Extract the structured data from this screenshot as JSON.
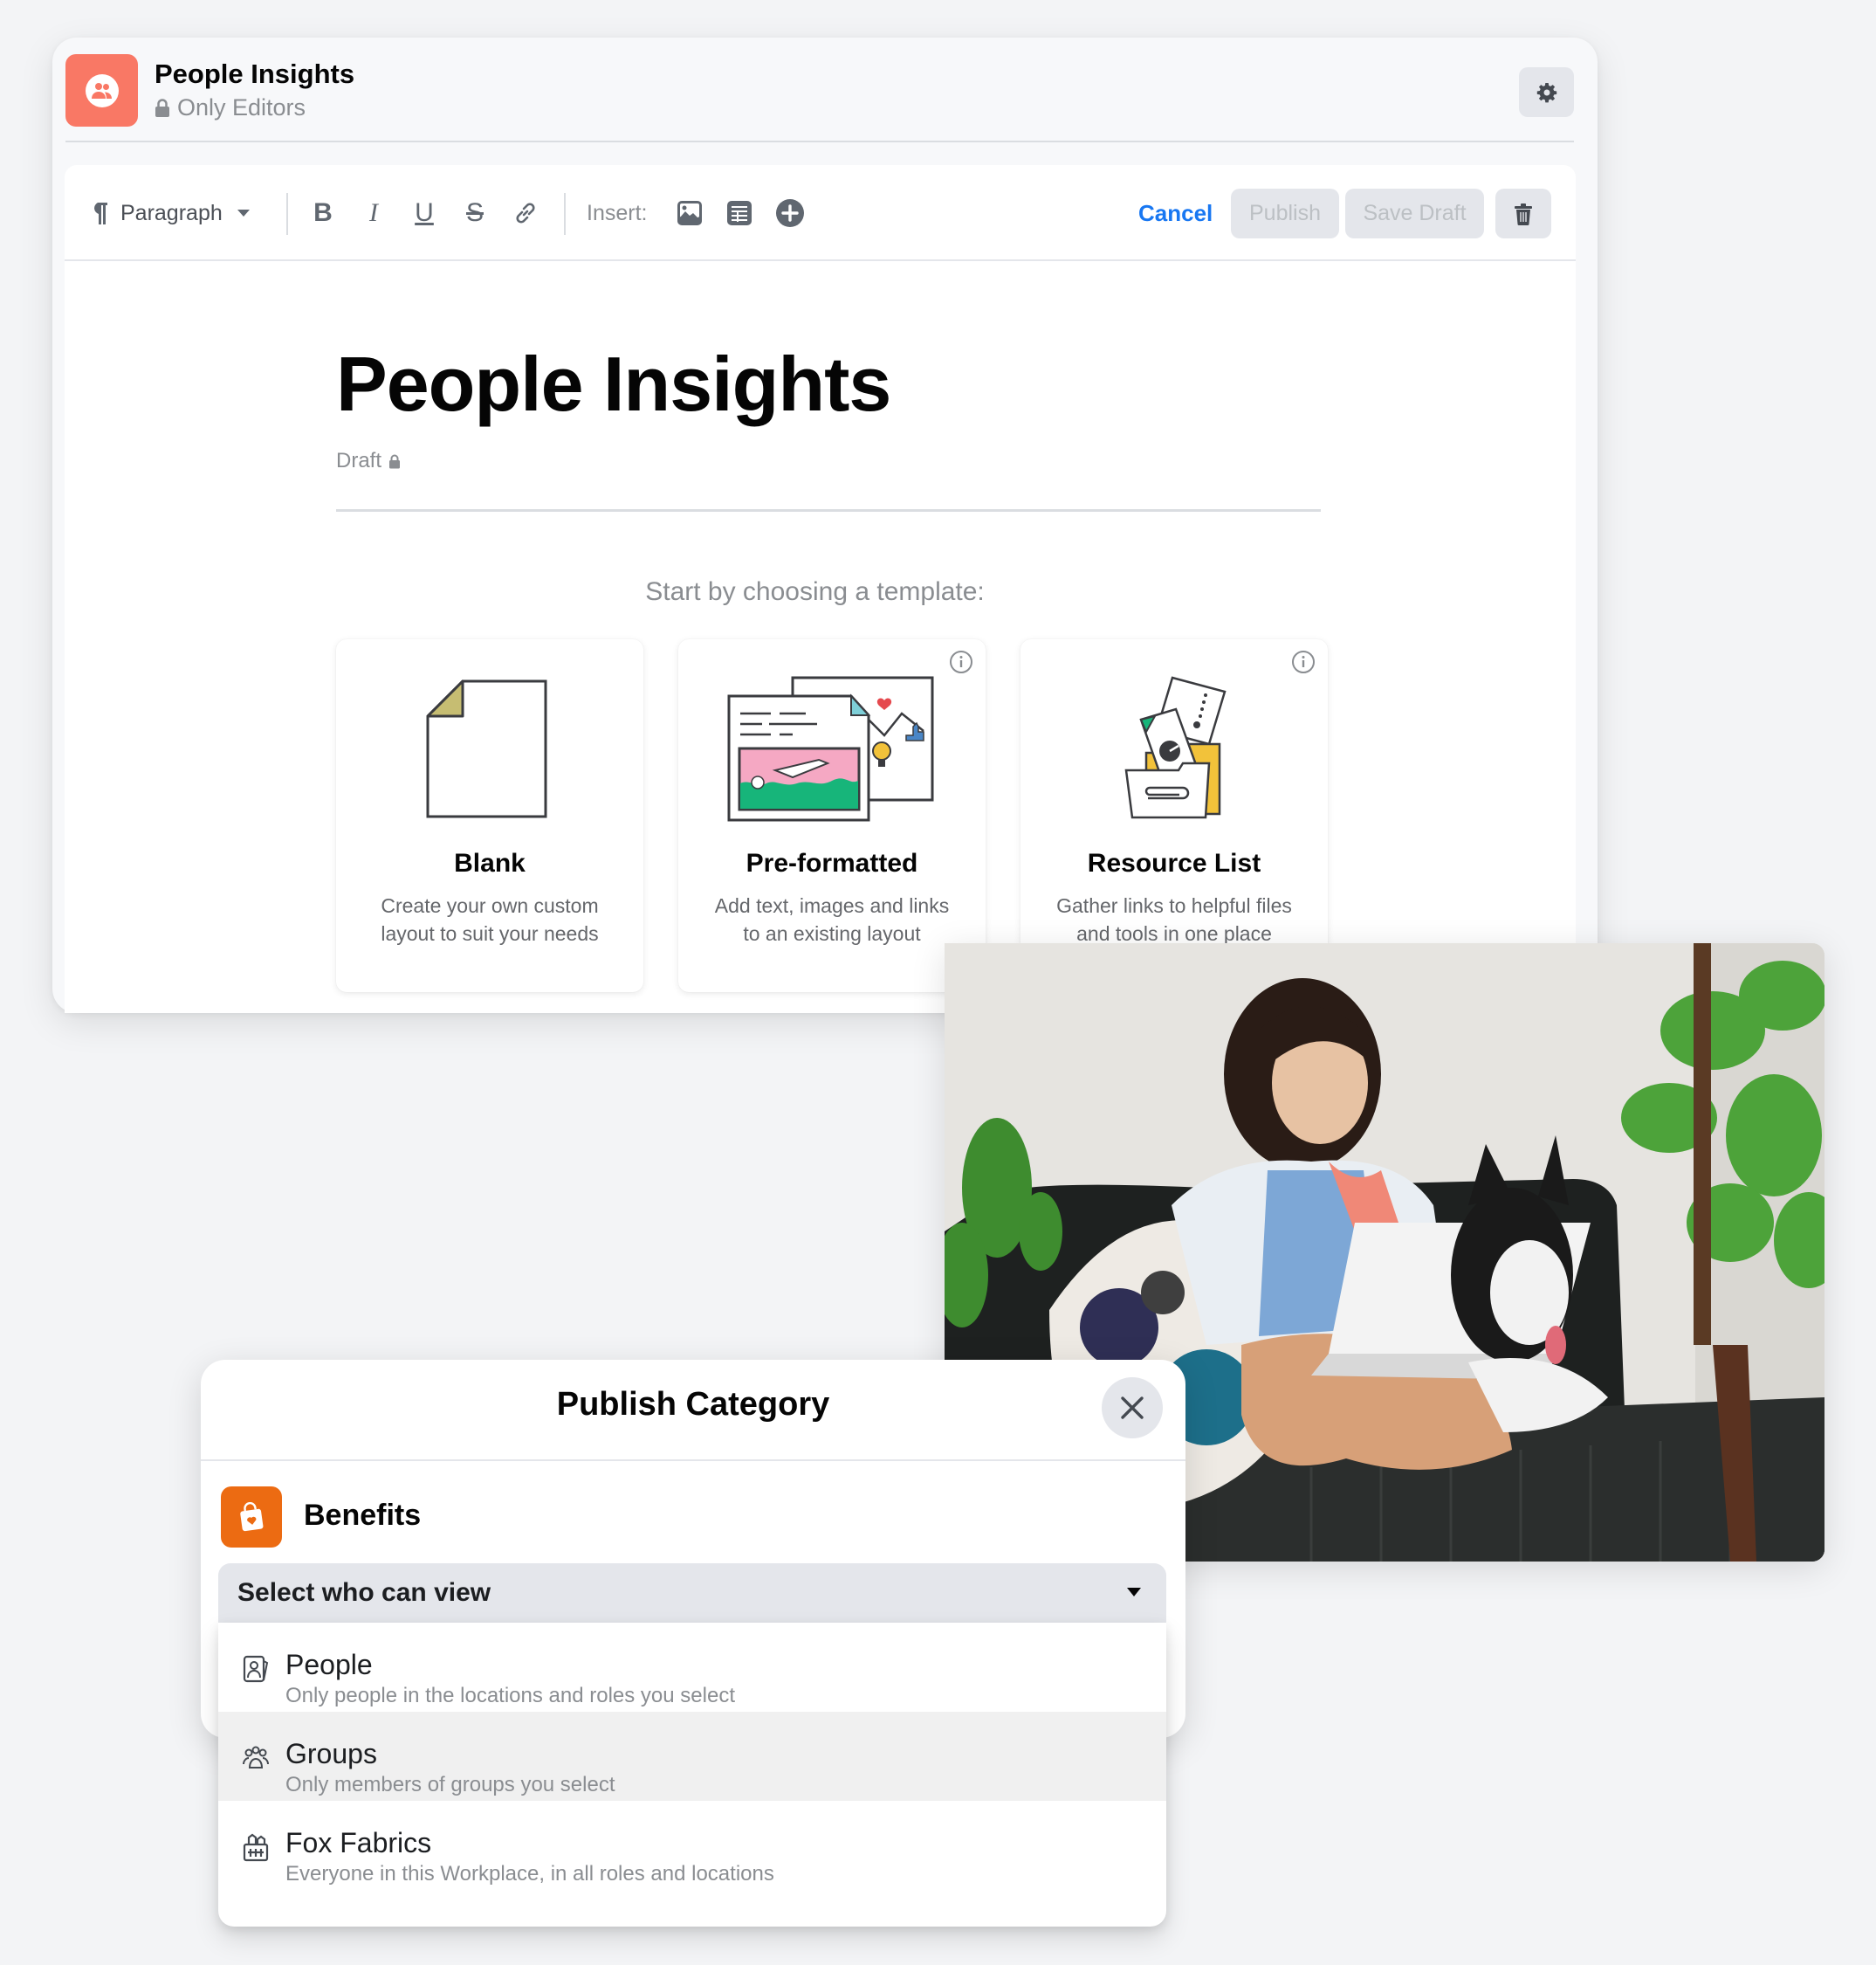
{
  "editor": {
    "header": {
      "title": "People Insights",
      "visibility": "Only Editors",
      "app_icon": "people-group-icon",
      "settings_icon": "gear-icon",
      "app_color": "#f97865"
    },
    "toolbar": {
      "block_style": "Paragraph",
      "format_buttons": [
        {
          "name": "bold",
          "glyph": "B"
        },
        {
          "name": "italic",
          "glyph": "I"
        },
        {
          "name": "underline",
          "glyph": "U"
        },
        {
          "name": "strikethrough",
          "glyph": "S"
        },
        {
          "name": "link",
          "glyph": "link"
        }
      ],
      "insert_label": "Insert:",
      "insert_buttons": [
        "image-icon",
        "table-icon",
        "plus-circle-icon"
      ],
      "cancel_label": "Cancel",
      "publish_label": "Publish",
      "save_draft_label": "Save Draft",
      "delete_icon": "trash-icon",
      "accent_color": "#1877f2"
    },
    "document": {
      "title": "People Insights",
      "status": "Draft",
      "template_prompt": "Start by choosing a template:"
    },
    "templates": [
      {
        "name": "Blank",
        "description_line1": "Create your own custom",
        "description_line2": "layout to suit your needs",
        "has_info": false
      },
      {
        "name": "Pre-formatted",
        "description_line1": "Add text, images and links",
        "description_line2": "to an existing layout",
        "has_info": true
      },
      {
        "name": "Resource List",
        "description_line1": "Gather links to helpful files",
        "description_line2": "and tools in one place",
        "has_info": true
      }
    ]
  },
  "photo": {
    "alt": "Woman on a leather sofa typing on a laptop next to a husky dog"
  },
  "publish_modal": {
    "title": "Publish Category",
    "close_icon": "close-icon",
    "category": {
      "name": "Benefits",
      "icon": "shopping-bag-heart-icon",
      "color": "#ec6b12"
    },
    "select": {
      "label": "Select who can view",
      "icon": "caret-down-icon"
    },
    "options": [
      {
        "title": "People",
        "description": "Only people in the locations and roles you select",
        "icon": "person-badge-icon",
        "highlighted": false
      },
      {
        "title": "Groups",
        "description": "Only members of groups you select",
        "icon": "groups-icon",
        "highlighted": true
      },
      {
        "title": "Fox Fabrics",
        "description": "Everyone in this Workplace, in all roles and locations",
        "icon": "building-icon",
        "highlighted": false
      }
    ]
  }
}
